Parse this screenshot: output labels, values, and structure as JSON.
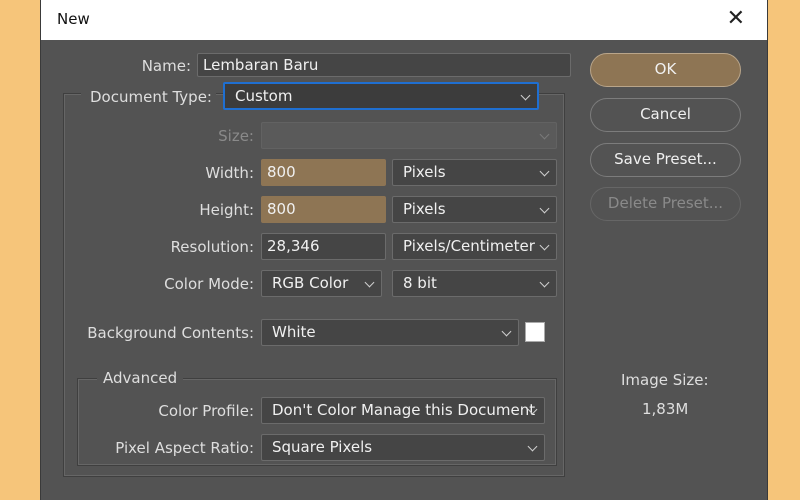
{
  "window": {
    "title": "New",
    "close_glyph": "✕"
  },
  "form": {
    "name_label": "Name:",
    "name_value": "Lembaran Baru",
    "document_type_label": "Document Type:",
    "document_type_value": "Custom",
    "size_label": "Size:",
    "size_value": "",
    "width_label": "Width:",
    "width_value": "800",
    "width_unit": "Pixels",
    "height_label": "Height:",
    "height_value": "800",
    "height_unit": "Pixels",
    "resolution_label": "Resolution:",
    "resolution_value": "28,346",
    "resolution_unit": "Pixels/Centimeter",
    "color_mode_label": "Color Mode:",
    "color_mode_value": "RGB Color",
    "bit_depth_value": "8 bit",
    "background_label": "Background Contents:",
    "background_value": "White",
    "background_swatch_color": "#ffffff"
  },
  "advanced": {
    "title": "Advanced",
    "color_profile_label": "Color Profile:",
    "color_profile_value": "Don't Color Manage this Document",
    "pixel_aspect_label": "Pixel Aspect Ratio:",
    "pixel_aspect_value": "Square Pixels"
  },
  "buttons": {
    "ok": "OK",
    "cancel": "Cancel",
    "save_preset": "Save Preset...",
    "delete_preset": "Delete Preset..."
  },
  "image_size": {
    "label": "Image Size:",
    "value": "1,83M"
  }
}
